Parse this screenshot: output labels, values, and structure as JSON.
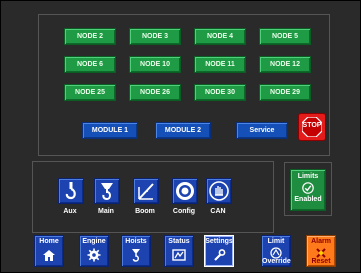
{
  "nodes": [
    "NODE 2",
    "NODE 3",
    "NODE 4",
    "NODE 5",
    "NODE 6",
    "NODE 10",
    "NODE 11",
    "NODE 12",
    "NODE 25",
    "NODE 26",
    "NODE 30",
    "NODE 29"
  ],
  "modules": [
    "MODULE 1",
    "MODULE 2",
    "Service"
  ],
  "stop_label": "STOP",
  "functions": [
    {
      "label": "Aux",
      "icon": "hook-icon"
    },
    {
      "label": "Main",
      "icon": "winch-hook-icon"
    },
    {
      "label": "Boom",
      "icon": "boom-icon"
    },
    {
      "label": "Config",
      "icon": "config-icon"
    },
    {
      "label": "CAN",
      "icon": "can-icon"
    }
  ],
  "limits": {
    "line1": "Limits",
    "line2": "Enabled",
    "icon": "checkmark-icon"
  },
  "bottom_nav": [
    {
      "label": "Home",
      "icon": "home-icon"
    },
    {
      "label": "Engine",
      "icon": "gear-icon"
    },
    {
      "label": "Hoists",
      "icon": "hoist-icon"
    },
    {
      "label": "Status",
      "icon": "status-icon"
    },
    {
      "label": "Settings",
      "icon": "wrench-icon",
      "selected": true
    }
  ],
  "limit_override": {
    "line1": "Limit",
    "line2": "Override",
    "icon": "override-icon"
  },
  "alarm_reset": {
    "line1": "Alarm",
    "line2": "Reset",
    "icon": "alarm-reset-icon"
  },
  "colors": {
    "node": "#1f9a45",
    "module": "#1550b8",
    "stop": "#e31b1b",
    "limits": "#1f8d3f",
    "alarm": "#ff7a1a"
  }
}
